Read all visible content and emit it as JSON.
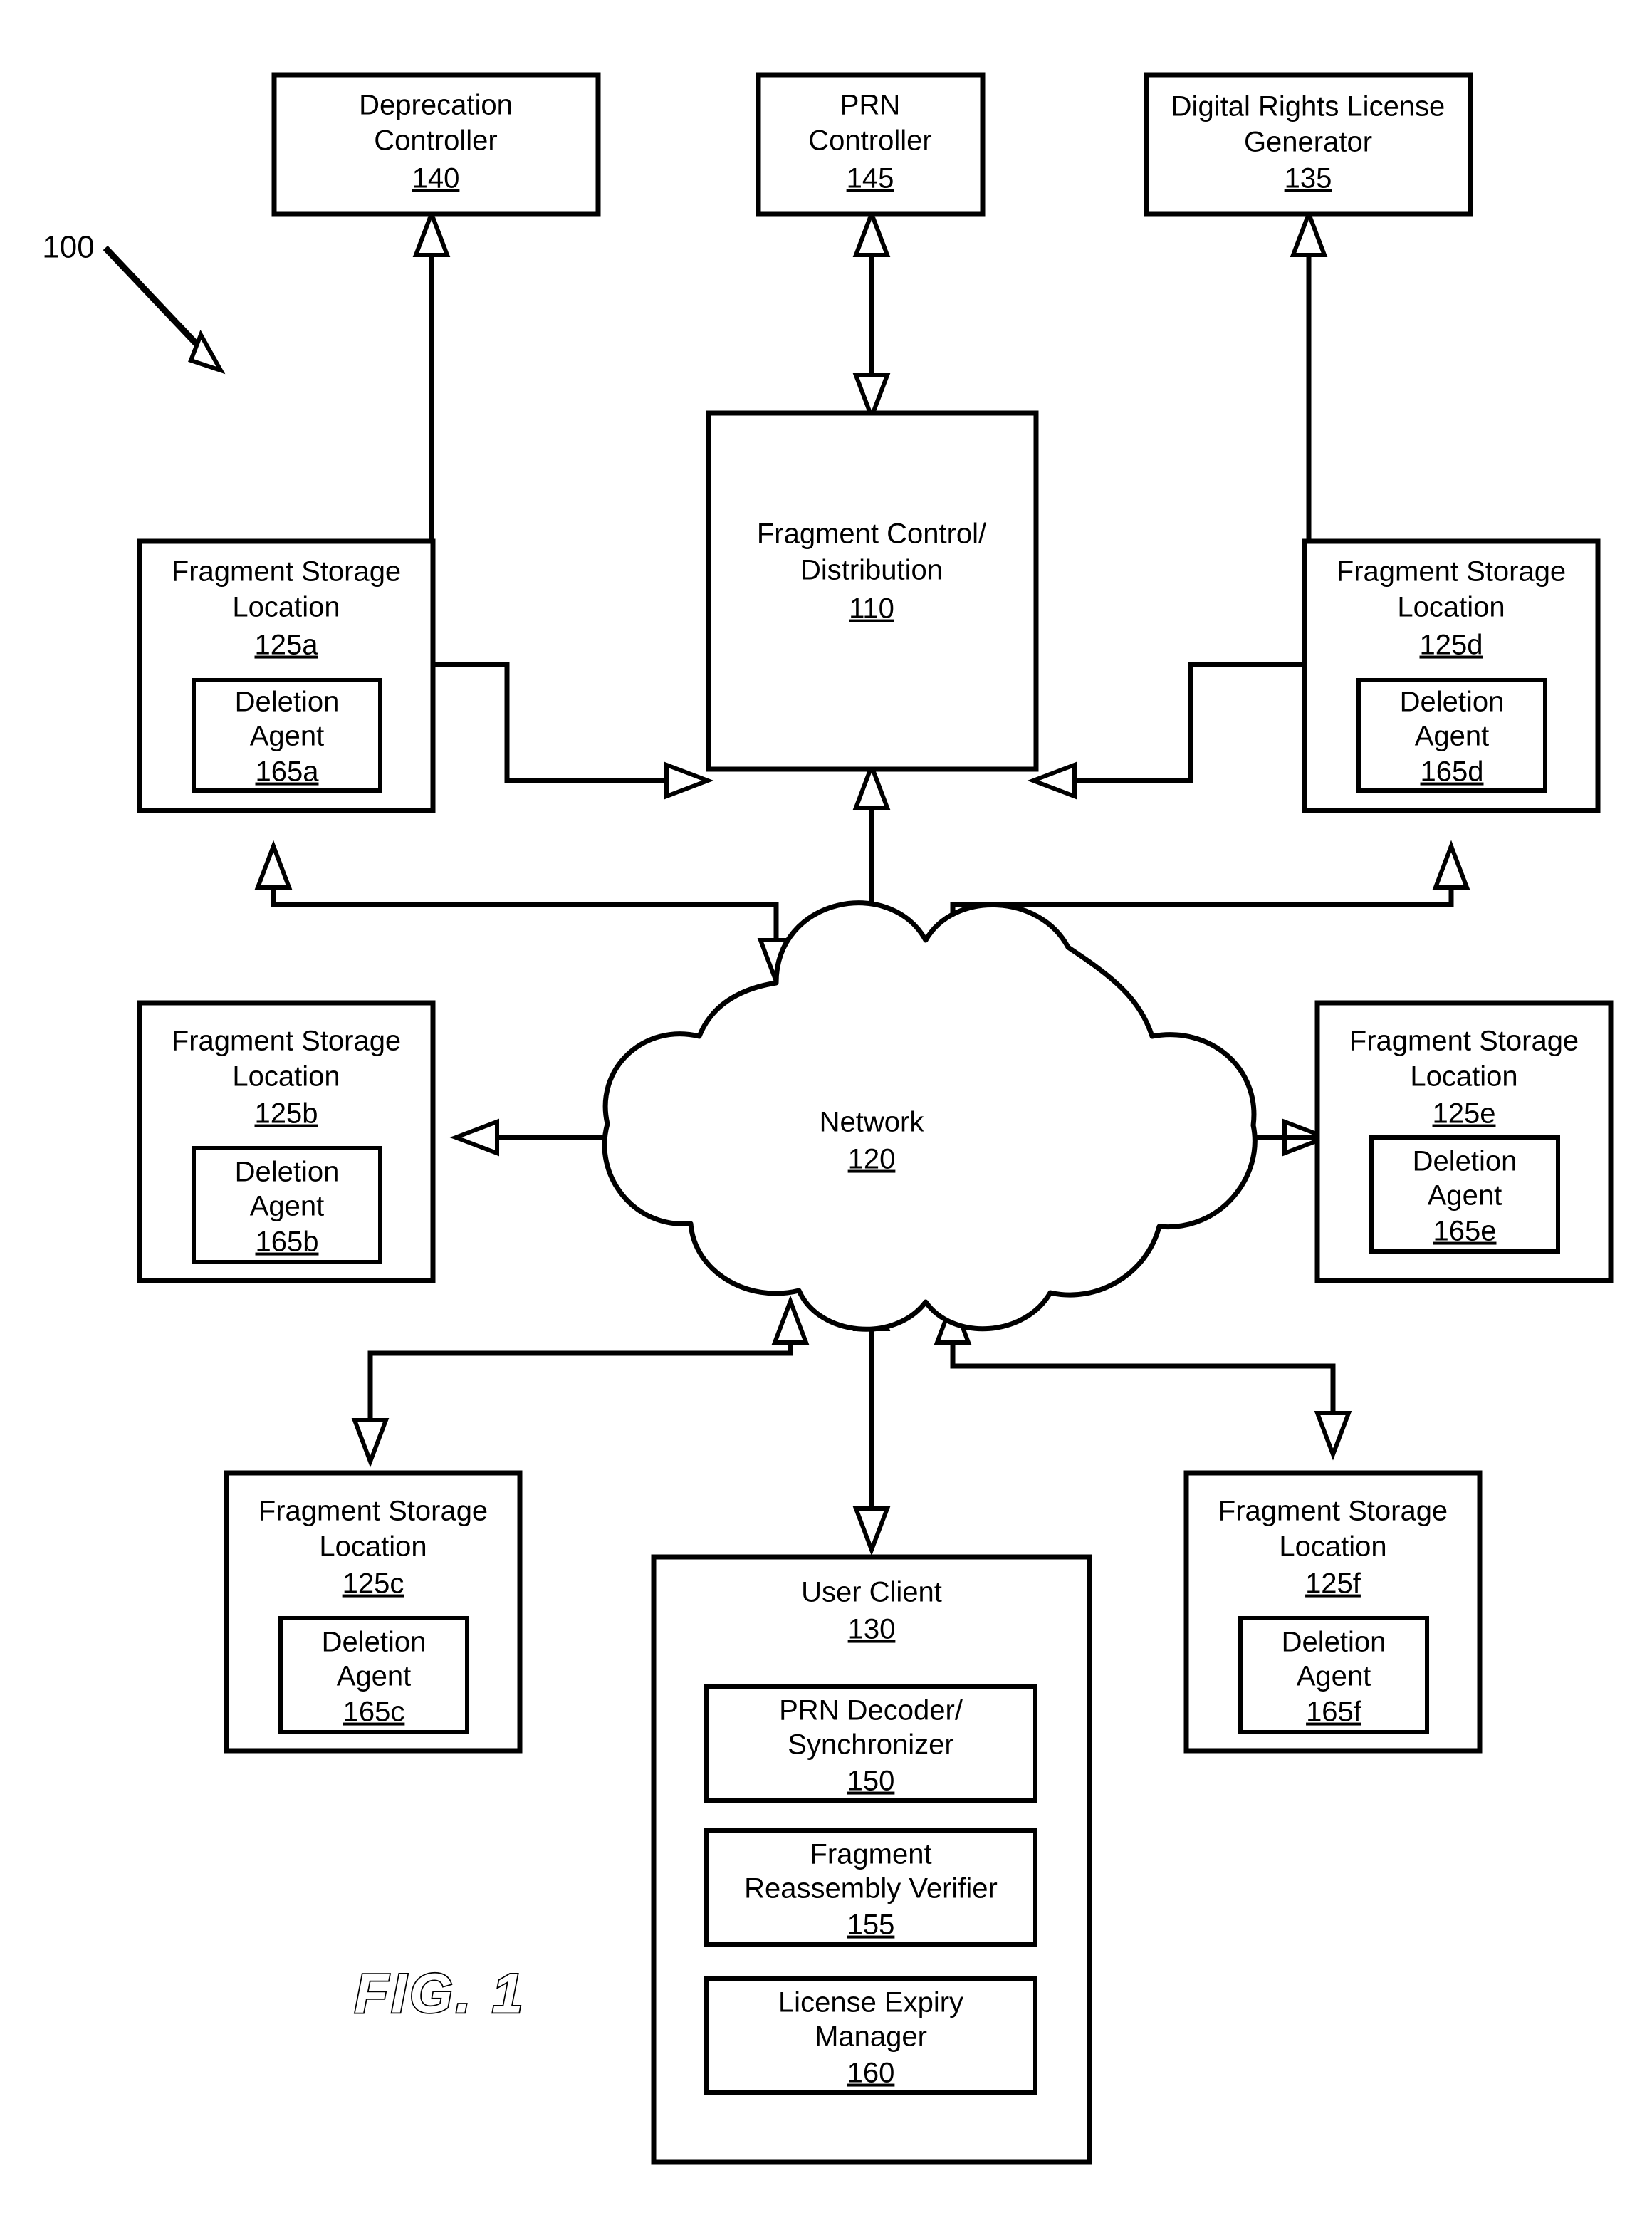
{
  "figure": {
    "caption": "FIG. 1",
    "system_reference": "100"
  },
  "nodes": {
    "deprecation_controller": {
      "line1": "Deprecation",
      "line2": "Controller",
      "ref": "140"
    },
    "prn_controller": {
      "line1": "PRN",
      "line2": "Controller",
      "ref": "145"
    },
    "drm_license_generator": {
      "line1": "Digital Rights License",
      "line2": "Generator",
      "ref": "135"
    },
    "fragment_control": {
      "line1": "Fragment Control/",
      "line2": "Distribution",
      "ref": "110"
    },
    "network": {
      "line1": "Network",
      "ref": "120"
    },
    "user_client": {
      "line1": "User Client",
      "ref": "130",
      "modules": [
        {
          "line1": "PRN Decoder/",
          "line2": "Synchronizer",
          "ref": "150"
        },
        {
          "line1": "Fragment",
          "line2": "Reassembly Verifier",
          "ref": "155"
        },
        {
          "line1": "License Expiry",
          "line2": "Manager",
          "ref": "160"
        }
      ]
    },
    "storage_locations": [
      {
        "id": "a",
        "line1": "Fragment Storage",
        "line2": "Location",
        "ref": "125a",
        "agent": {
          "line1": "Deletion",
          "line2": "Agent",
          "ref": "165a"
        }
      },
      {
        "id": "b",
        "line1": "Fragment Storage",
        "line2": "Location",
        "ref": "125b",
        "agent": {
          "line1": "Deletion",
          "line2": "Agent",
          "ref": "165b"
        }
      },
      {
        "id": "c",
        "line1": "Fragment Storage",
        "line2": "Location",
        "ref": "125c",
        "agent": {
          "line1": "Deletion",
          "line2": "Agent",
          "ref": "165c"
        }
      },
      {
        "id": "d",
        "line1": "Fragment Storage",
        "line2": "Location",
        "ref": "125d",
        "agent": {
          "line1": "Deletion",
          "line2": "Agent",
          "ref": "165d"
        }
      },
      {
        "id": "e",
        "line1": "Fragment Storage",
        "line2": "Location",
        "ref": "125e",
        "agent": {
          "line1": "Deletion",
          "line2": "Agent",
          "ref": "165e"
        }
      },
      {
        "id": "f",
        "line1": "Fragment Storage",
        "line2": "Location",
        "ref": "125f",
        "agent": {
          "line1": "Deletion",
          "line2": "Agent",
          "ref": "165f"
        }
      }
    ]
  },
  "colors": {
    "ink": "#000000",
    "paper": "#ffffff"
  }
}
